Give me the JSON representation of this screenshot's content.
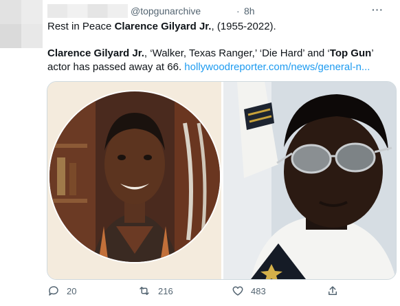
{
  "tweet": {
    "handle": "@topgunarchive",
    "separator": "·",
    "time": "8h",
    "more_label": "···",
    "text_line1": {
      "prefix": "Rest in Peace ",
      "bold_name": "Clarence Gilyard Jr.",
      "suffix": ", (1955-2022)."
    },
    "text_line2": {
      "bold_name": "Clarence Gilyard Jr.",
      "middle": ", ‘Walker, Texas Ranger,’ ‘Die Hard’ and ‘",
      "bold_title": "Top Gun",
      "end": "’"
    },
    "text_line3": {
      "prefix": "actor has passed away at 66. ",
      "link": "hollywoodreporter.com/news/general-n..."
    }
  },
  "actions": {
    "reply_count": "20",
    "retweet_count": "216",
    "like_count": "483"
  },
  "icons": {
    "reply": "reply-icon",
    "retweet": "retweet-icon",
    "like": "heart-icon",
    "share": "share-icon",
    "more": "more-icon"
  },
  "colors": {
    "link": "#1d9bf0",
    "muted": "#536471"
  }
}
